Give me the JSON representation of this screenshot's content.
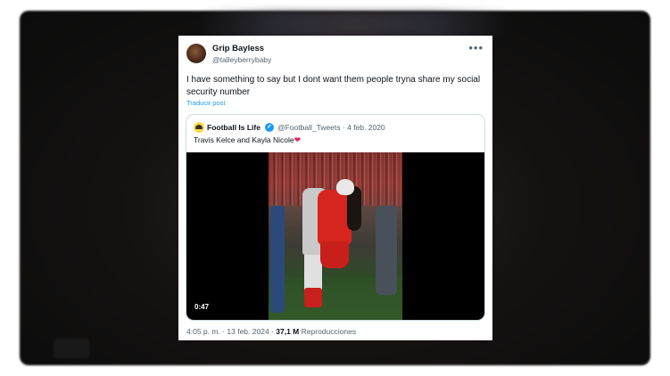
{
  "post": {
    "author_name": "Grip Bayless",
    "author_handle": "@talleyberrybaby",
    "text": "I have something to say but I dont want them people tryna share my social security number",
    "translate_label": "Traducir post",
    "more_icon": "more-icon"
  },
  "quoted": {
    "author_name": "Football Is Life",
    "author_handle": "@Football_Tweets",
    "date": "4 feb. 2020",
    "text": "Travis Kelce and Kayla Nicole",
    "emoji": "❤",
    "video_duration": "0:47"
  },
  "footer": {
    "time": "4:05 p. m.",
    "separator": "·",
    "date": "13 feb. 2024",
    "views_count": "37,1 M",
    "views_label": "Reproducciones"
  },
  "colors": {
    "accent": "#1d9bf0",
    "text": "#0f1419",
    "muted": "#536471",
    "heart": "#e0245e"
  }
}
